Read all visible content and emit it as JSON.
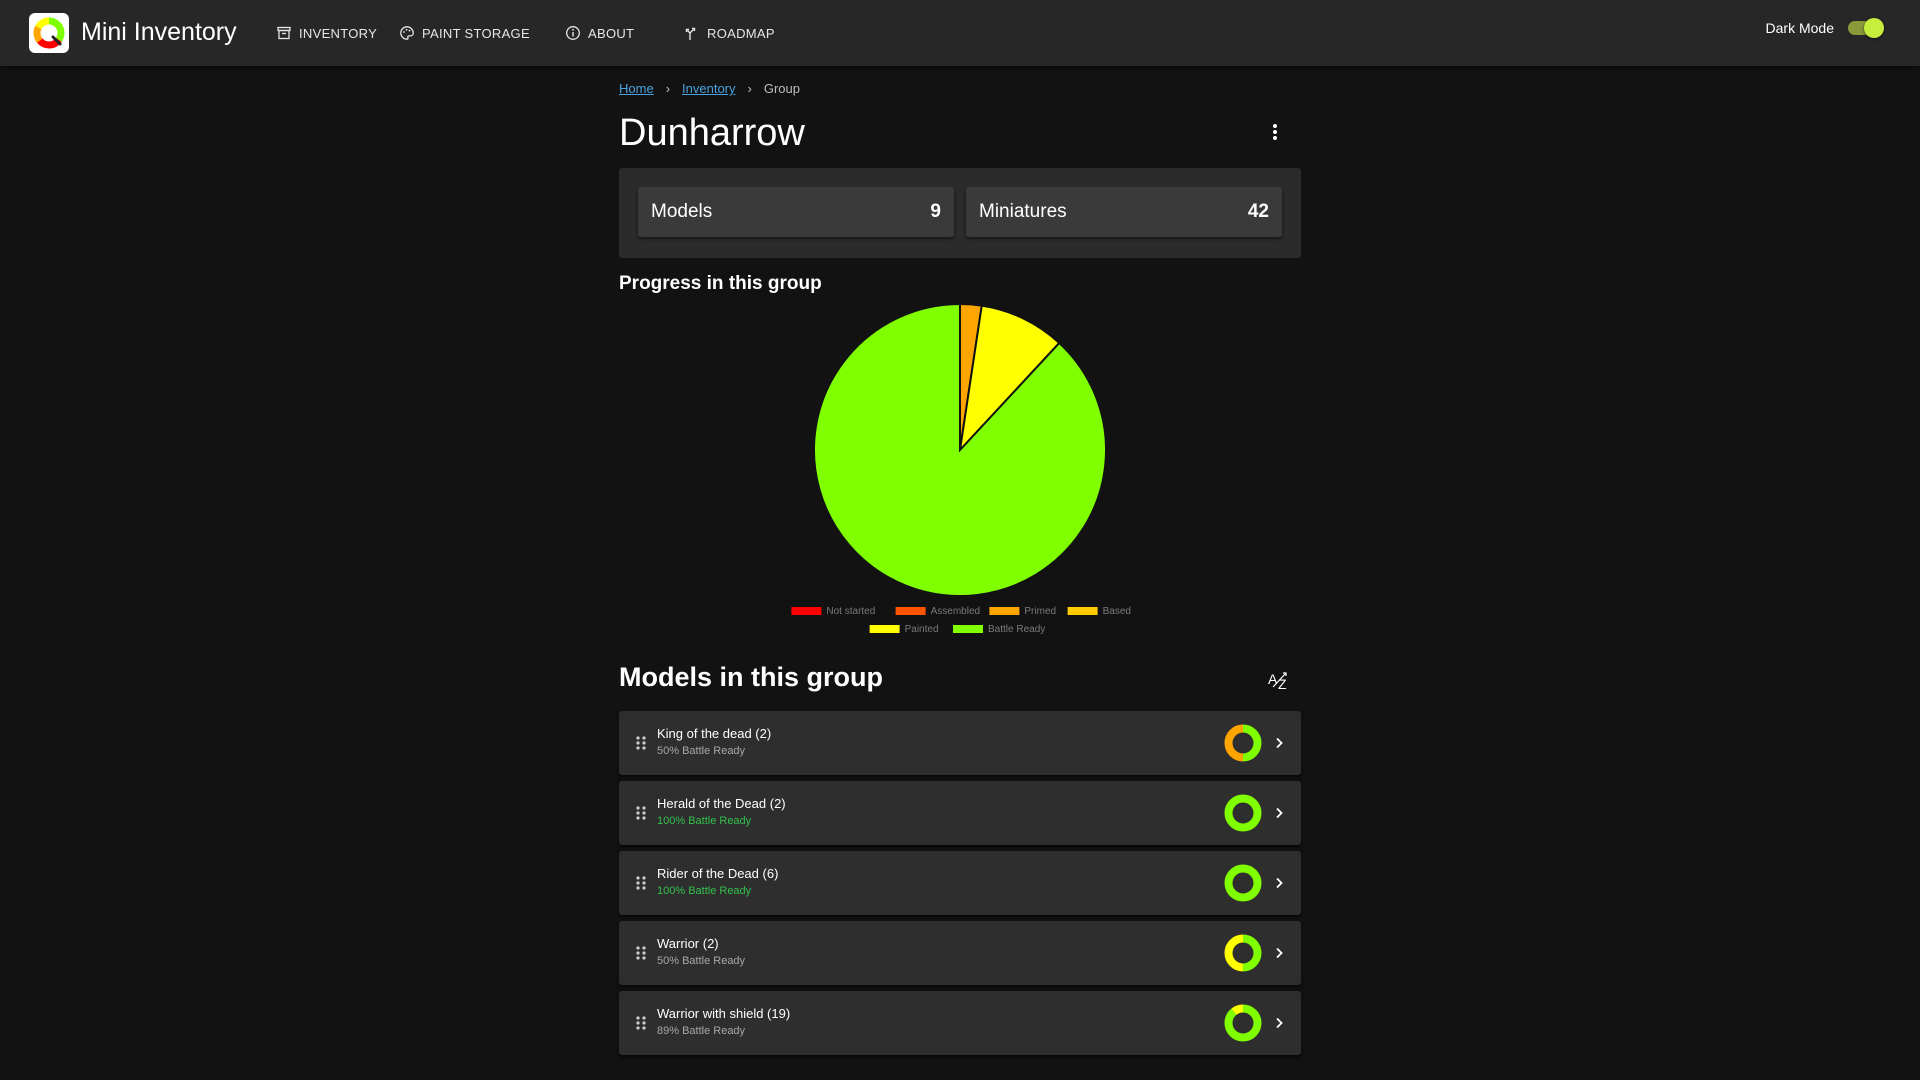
{
  "app": {
    "title": "Mini Inventory"
  },
  "nav": [
    {
      "label": "INVENTORY",
      "icon": "archive-icon"
    },
    {
      "label": "PAINT STORAGE",
      "icon": "palette-icon"
    },
    {
      "label": "ABOUT",
      "icon": "info-icon"
    },
    {
      "label": "ROADMAP",
      "icon": "roadmap-icon"
    }
  ],
  "darkmode": {
    "label": "Dark Mode",
    "enabled": true
  },
  "breadcrumb": {
    "home": "Home",
    "inventory": "Inventory",
    "current": "Group"
  },
  "page": {
    "title": "Dunharrow"
  },
  "stats": {
    "models_label": "Models",
    "models_value": "9",
    "miniatures_label": "Miniatures",
    "miniatures_value": "42"
  },
  "progress": {
    "heading": "Progress in this group"
  },
  "chart_data": {
    "type": "pie",
    "categories": [
      "Not started",
      "Assembled",
      "Primed",
      "Based",
      "Painted",
      "Battle Ready"
    ],
    "values": [
      0,
      0,
      1,
      0,
      4,
      37
    ],
    "colors": [
      "#ff0000",
      "#ff5500",
      "#ffa500",
      "#ffcc00",
      "#ffff00",
      "#7fff00"
    ],
    "legend": "bottom"
  },
  "models_section": {
    "heading": "Models in this group",
    "sort_icon": "sort-az-icon"
  },
  "models": [
    {
      "name": "King of the dead (2)",
      "status": "50% Battle Ready",
      "complete": false,
      "colors": [
        "#7fff00",
        "#ffa500"
      ],
      "fractions": [
        0.5,
        0.5
      ]
    },
    {
      "name": "Herald of the Dead (2)",
      "status": "100% Battle Ready",
      "complete": true,
      "colors": [
        "#7fff00"
      ],
      "fractions": [
        1
      ]
    },
    {
      "name": "Rider of the Dead (6)",
      "status": "100% Battle Ready",
      "complete": true,
      "colors": [
        "#7fff00"
      ],
      "fractions": [
        1
      ]
    },
    {
      "name": "Warrior (2)",
      "status": "50% Battle Ready",
      "complete": false,
      "colors": [
        "#7fff00",
        "#ffff00"
      ],
      "fractions": [
        0.5,
        0.5
      ]
    },
    {
      "name": "Warrior with shield (19)",
      "status": "89% Battle Ready",
      "complete": false,
      "colors": [
        "#7fff00",
        "#ffff00"
      ],
      "fractions": [
        0.89,
        0.11
      ]
    }
  ]
}
